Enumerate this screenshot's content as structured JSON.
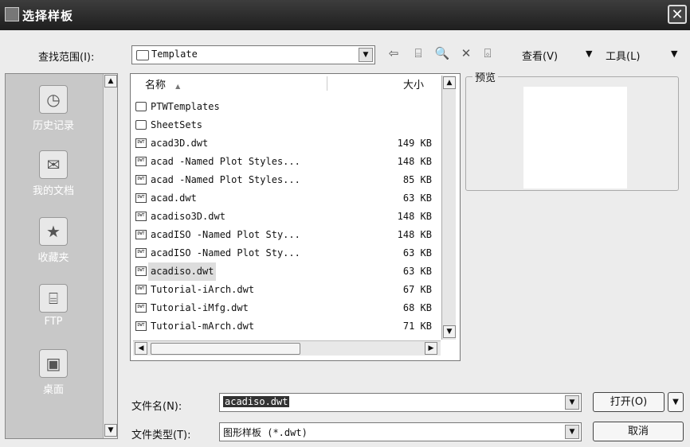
{
  "window": {
    "title": "选择样板",
    "close_glyph": "✕"
  },
  "lookin": {
    "label": "查找范围(I):",
    "value": "Template"
  },
  "toolbar": {
    "back_glyph": "⇦",
    "up_glyph": "⌸",
    "search_glyph": "🔍",
    "delete_glyph": "✕",
    "newfolder_glyph": "⌺",
    "views_label": "查看(V)",
    "tools_label": "工具(L)",
    "dropdown_glyph": "▼"
  },
  "places": [
    {
      "label": "历史记录",
      "icon": "history-icon",
      "glyph": "◷"
    },
    {
      "label": "我的文档",
      "icon": "my-documents-icon",
      "glyph": "✉"
    },
    {
      "label": "收藏夹",
      "icon": "favorites-icon",
      "glyph": "★"
    },
    {
      "label": "FTP",
      "icon": "ftp-icon",
      "glyph": "⌸"
    },
    {
      "label": "桌面",
      "icon": "desktop-icon",
      "glyph": "▣"
    }
  ],
  "filelist": {
    "col_name": "名称",
    "sort_glyph": "▲",
    "col_size": "大小",
    "rows": [
      {
        "name": "PTWTemplates",
        "size": "",
        "type": "folder"
      },
      {
        "name": "SheetSets",
        "size": "",
        "type": "folder"
      },
      {
        "name": "acad3D.dwt",
        "size": "149 KB",
        "type": "dwt"
      },
      {
        "name": "acad -Named Plot Styles...",
        "size": "148 KB",
        "type": "dwt"
      },
      {
        "name": "acad -Named Plot Styles...",
        "size": "85 KB",
        "type": "dwt"
      },
      {
        "name": "acad.dwt",
        "size": "63 KB",
        "type": "dwt"
      },
      {
        "name": "acadiso3D.dwt",
        "size": "148 KB",
        "type": "dwt"
      },
      {
        "name": "acadISO -Named Plot Sty...",
        "size": "148 KB",
        "type": "dwt"
      },
      {
        "name": "acadISO -Named Plot Sty...",
        "size": "63 KB",
        "type": "dwt"
      },
      {
        "name": "acadiso.dwt",
        "size": "63 KB",
        "type": "dwt",
        "selected": true
      },
      {
        "name": "Tutorial-iArch.dwt",
        "size": "67 KB",
        "type": "dwt"
      },
      {
        "name": "Tutorial-iMfg.dwt",
        "size": "68 KB",
        "type": "dwt"
      },
      {
        "name": "Tutorial-mArch.dwt",
        "size": "71 KB",
        "type": "dwt"
      }
    ],
    "dwt_badge": "DWT"
  },
  "preview": {
    "title": "预览"
  },
  "filename": {
    "label": "文件名(N):",
    "value": "acadiso.dwt"
  },
  "filetype": {
    "label": "文件类型(T):",
    "value": "图形样板 (*.dwt)"
  },
  "buttons": {
    "open": "打开(O)",
    "cancel": "取消"
  },
  "arrows": {
    "up": "▲",
    "down": "▼",
    "left": "◀",
    "right": "▶",
    "combo": "▼"
  }
}
